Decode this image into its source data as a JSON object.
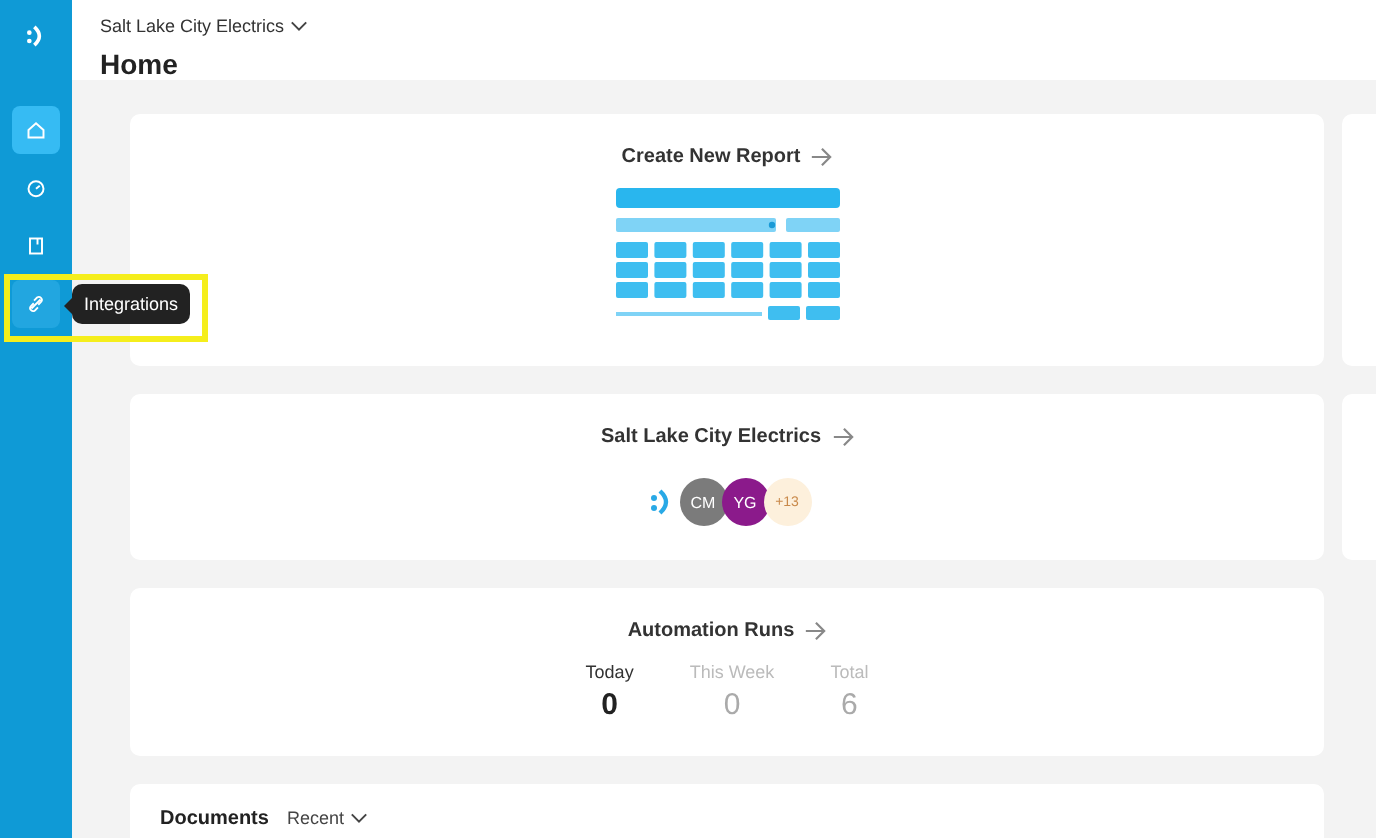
{
  "sidebar": {
    "items": [
      {
        "kind": "home",
        "selected": true,
        "hovered": false
      },
      {
        "kind": "gauge",
        "selected": false,
        "hovered": false
      },
      {
        "kind": "book",
        "selected": false,
        "hovered": false
      },
      {
        "kind": "link",
        "selected": false,
        "hovered": true,
        "tooltip": "Integrations"
      }
    ]
  },
  "header": {
    "workspace": "Salt Lake City Electrics",
    "title": "Home"
  },
  "report_card": {
    "title": "Create New Report"
  },
  "team_card": {
    "title": "Salt Lake City Electrics",
    "avatars": [
      {
        "kind": "logo",
        "color": "#ffffff"
      },
      {
        "kind": "initials",
        "label": "CM",
        "color": "#7b7b7b"
      },
      {
        "kind": "initials",
        "label": "YG",
        "color": "#8b1a8b"
      },
      {
        "kind": "count",
        "label": "+13",
        "color": "#fdf0dc"
      }
    ]
  },
  "automation_card": {
    "title": "Automation Runs",
    "stats": [
      {
        "label": "Today",
        "value": "0",
        "selected": true
      },
      {
        "label": "This Week",
        "value": "0",
        "selected": false
      },
      {
        "label": "Total",
        "value": "6",
        "selected": false
      }
    ]
  },
  "documents": {
    "title": "Documents",
    "filter": "Recent"
  }
}
